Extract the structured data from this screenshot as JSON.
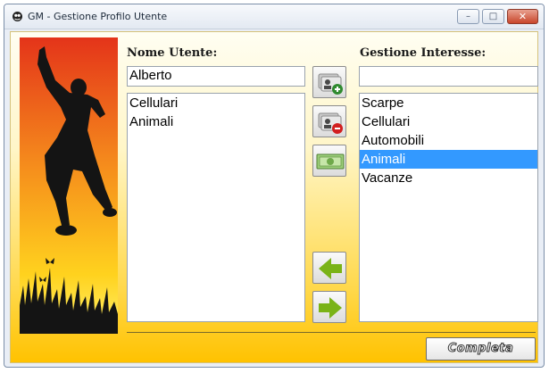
{
  "window": {
    "title": "GM - Gestione Profilo Utente",
    "app_icon": "app-logo-icon",
    "controls": {
      "minimize": "–",
      "maximize": "□",
      "close": "✕"
    }
  },
  "banner": {
    "image": "jumping-silhouette-sunset-banner"
  },
  "user_panel": {
    "label": "Nome Utente:",
    "name_value": "Alberto",
    "interests": [
      "Cellulari",
      "Animali"
    ]
  },
  "interest_panel": {
    "label": "Gestione Interesse:",
    "input_value": "",
    "options": [
      "Scarpe",
      "Cellulari",
      "Automobili",
      "Animali",
      "Vacanze"
    ],
    "selected": "Animali"
  },
  "toolbar": {
    "add_user_icon": "add-user-icon",
    "remove_user_icon": "remove-user-icon",
    "money_icon": "money-icon",
    "left_arrow_icon": "arrow-left-icon",
    "right_arrow_icon": "arrow-right-icon"
  },
  "actions": {
    "complete_label": "Completa"
  },
  "colors": {
    "selection": "#3399ff",
    "background_top": "#fffef2",
    "background_bottom": "#ffc200",
    "arrow_green": "#7ab317"
  }
}
